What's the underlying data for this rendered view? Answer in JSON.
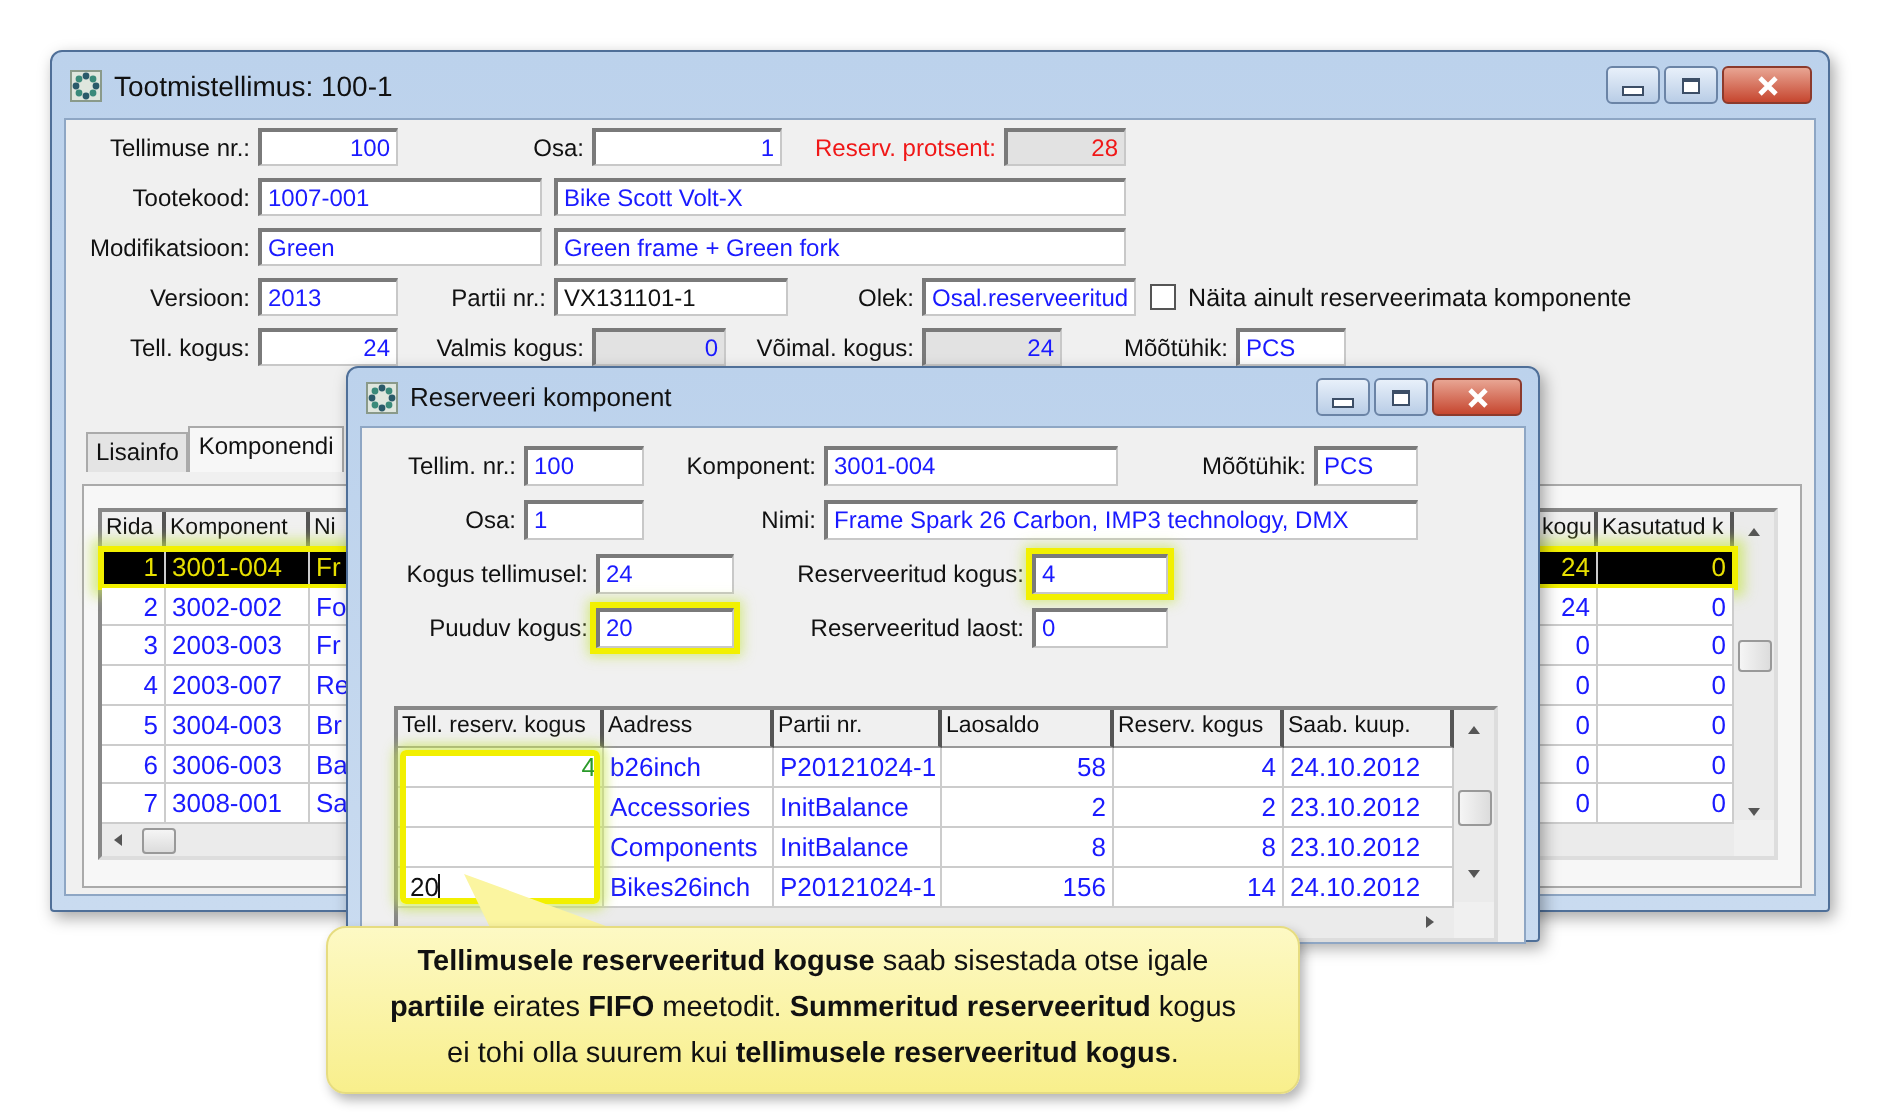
{
  "main_window": {
    "title": "Tootmistellimus: 100-1",
    "order_no": {
      "label": "Tellimuse nr.:",
      "value": "100"
    },
    "part": {
      "label": "Osa:",
      "value": "1"
    },
    "reserve_percent": {
      "label": "Reserv. protsent:",
      "value": "28"
    },
    "product_code": {
      "label": "Tootekood:",
      "value": "1007-001",
      "description": "Bike Scott Volt-X"
    },
    "modification": {
      "label": "Modifikatsioon:",
      "value": "Green",
      "description": "Green frame + Green fork"
    },
    "version": {
      "label": "Versioon:",
      "value": "2013"
    },
    "batch": {
      "label": "Partii nr.:",
      "value": "VX131101-1"
    },
    "status": {
      "label": "Olek:",
      "value": "Osal.reserveeritud"
    },
    "only_unreserved": {
      "label": "Näita ainult reserveerimata komponente",
      "checked": false
    },
    "ordered_qty": {
      "label": "Tell. kogus:",
      "value": "24"
    },
    "finished_qty": {
      "label": "Valmis kogus:",
      "value": "0"
    },
    "possible_qty": {
      "label": "Võimal. kogus:",
      "value": "24"
    },
    "unit": {
      "label": "Mõõtühik:",
      "value": "PCS"
    },
    "tabs": [
      {
        "label": "Lisainfo",
        "selected": false
      },
      {
        "label": "Komponendi",
        "selected": true
      }
    ],
    "components": {
      "columns": [
        "Rida",
        "Komponent",
        "Ni",
        "kogu",
        "Kasutatud k"
      ],
      "rows": [
        {
          "row": "1",
          "code": "3001-004",
          "name": "Fr",
          "qty": "24",
          "used": "0",
          "selected": true,
          "highlighted": true
        },
        {
          "row": "2",
          "code": "3002-002",
          "name": "Fo",
          "qty": "24",
          "used": "0",
          "selected": false
        },
        {
          "row": "3",
          "code": "2003-003",
          "name": "Fr",
          "qty": "0",
          "used": "0",
          "selected": false
        },
        {
          "row": "4",
          "code": "2003-007",
          "name": "Re",
          "qty": "0",
          "used": "0",
          "selected": false
        },
        {
          "row": "5",
          "code": "3004-003",
          "name": "Br",
          "qty": "0",
          "used": "0",
          "selected": false
        },
        {
          "row": "6",
          "code": "3006-003",
          "name": "Ba",
          "qty": "0",
          "used": "0",
          "selected": false
        },
        {
          "row": "7",
          "code": "3008-001",
          "name": "Sa",
          "qty": "0",
          "used": "0",
          "selected": false
        }
      ]
    }
  },
  "dialog": {
    "title": "Reserveeri komponent",
    "order_no": {
      "label": "Tellim. nr.:",
      "value": "100",
      "highlighted": false
    },
    "component": {
      "label": "Komponent:",
      "value": "3001-004",
      "highlighted": false
    },
    "unit": {
      "label": "Mõõtühik:",
      "value": "PCS",
      "highlighted": false
    },
    "part": {
      "label": "Osa:",
      "value": "1",
      "highlighted": false
    },
    "name": {
      "label": "Nimi:",
      "value": "Frame Spark 26 Carbon, IMP3 technology, DMX",
      "highlighted": false
    },
    "ordered_qty": {
      "label": "Kogus tellimusel:",
      "value": "24",
      "highlighted": false
    },
    "reserved_qty": {
      "label": "Reserveeritud kogus:",
      "value": "4",
      "highlighted": true
    },
    "missing_qty": {
      "label": "Puuduv kogus:",
      "value": "20",
      "highlighted": true
    },
    "reserved_from_stock": {
      "label": "Reserveeritud laost:",
      "value": "0",
      "highlighted": false
    },
    "lots": {
      "columns": [
        {
          "label": "Tell. reserv. kogus",
          "highlighted": true
        },
        {
          "label": "Aadress"
        },
        {
          "label": "Partii nr."
        },
        {
          "label": "Laosaldo"
        },
        {
          "label": "Reserv. kogus"
        },
        {
          "label": "Saab. kuup."
        }
      ],
      "rows": [
        {
          "order_reserve": "4",
          "editing": false,
          "address": "b26inch",
          "lot": "P20121024-1",
          "stock": "58",
          "reserved": "4",
          "arrival": "24.10.2012"
        },
        {
          "editing": false,
          "address": "Accessories",
          "lot": "InitBalance",
          "stock": "2",
          "reserved": "2",
          "arrival": "23.10.2012"
        },
        {
          "editing": false,
          "address": "Components",
          "lot": "InitBalance",
          "stock": "8",
          "reserved": "8",
          "arrival": "23.10.2012"
        },
        {
          "order_reserve": "20",
          "editing": true,
          "address": "Bikes26inch",
          "lot": "P20121024-1",
          "stock": "156",
          "reserved": "14",
          "arrival": "24.10.2012"
        }
      ]
    }
  },
  "callout": {
    "text": "**Tellimusele reserveeritud koguse** saab sisestada otse igale **partiile** eirates **FIFO** meetodit. **Summeritud reserveeritud** kogus ei tohi olla suurem kui **tellimusele reserveeritud kogus**."
  }
}
